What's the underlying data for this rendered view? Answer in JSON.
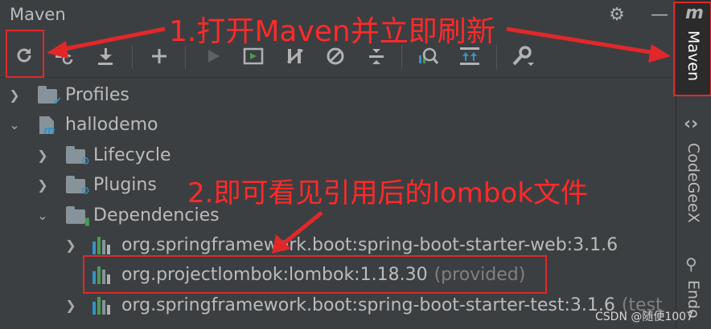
{
  "panel": {
    "title": "Maven"
  },
  "toolbar_icons": [
    "refresh-icon",
    "reimport-icon",
    "download-icon",
    "add-icon",
    "run-icon",
    "execute-goal-icon",
    "toggle-offline-icon",
    "skip-tests-icon",
    "collapse-all-icon",
    "analyze-dependencies-icon",
    "show-dependencies-icon",
    "settings-icon"
  ],
  "tree": {
    "profiles": "Profiles",
    "project": "hallodemo",
    "lifecycle": "Lifecycle",
    "plugins": "Plugins",
    "dependencies": "Dependencies",
    "deps": [
      {
        "label": "org.springframework.boot:spring-boot-starter-web:3.1.6"
      },
      {
        "label": "org.projectlombok:lombok:1.18.30",
        "scope": "(provided)"
      },
      {
        "label": "org.springframework.boot:spring-boot-starter-test:3.1.6",
        "scope": "(test"
      }
    ]
  },
  "sidebar": {
    "maven": "Maven",
    "codegeex": "CodeGeeX",
    "endpoints": "Endo"
  },
  "annotations": {
    "step1": "1.打开Maven并立即刷新",
    "step2": "2.即可看见引用后的lombok文件"
  },
  "watermark": "CSDN @随便1007",
  "colors": {
    "background": "#3c3f41",
    "annotation": "#e0282a",
    "text": "#bbbbbb"
  }
}
